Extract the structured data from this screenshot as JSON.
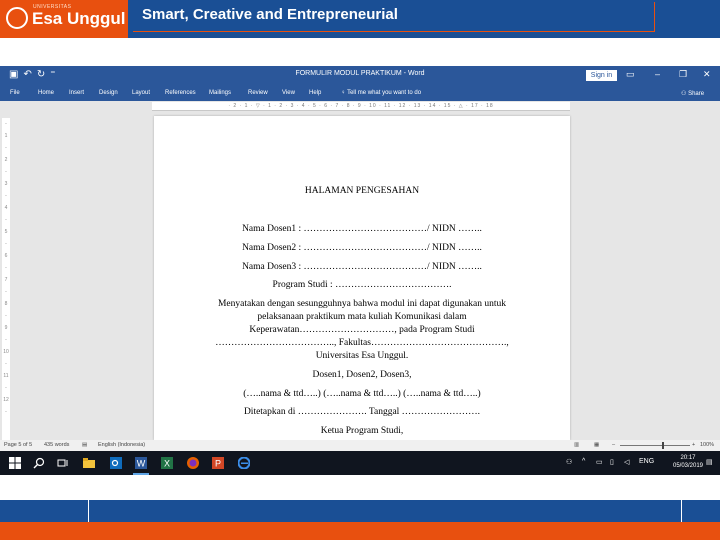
{
  "slide": {
    "logo_small": "UNIVERSITAS",
    "logo_text": "Esa Unggul",
    "banner_title": "Smart, Creative and Entrepreneurial"
  },
  "word": {
    "doc_title": "FORMULIR MODUL PRAKTIKUM - Word",
    "signin": "Sign in",
    "tabs": [
      "File",
      "Home",
      "Insert",
      "Design",
      "Layout",
      "References",
      "Mailings",
      "Review",
      "View",
      "Help"
    ],
    "tell_me": "Tell me what you want to do",
    "share": "Share"
  },
  "document": {
    "heading": "HALAMAN PENGESAHAN",
    "lines": [
      "Nama Dosen1 : …………………………………/ NIDN ……..",
      "Nama Dosen2 : …………………………………/ NIDN ……..",
      "Nama Dosen3 : …………………………………/ NIDN ……..",
      "Program Studi : ……………………………….",
      "Menyatakan dengan sesungguhnya bahwa modul ini dapat digunakan untuk",
      "pelaksanaan praktikum mata kuliah Komunikasi dalam",
      "Keperawatan…………………………, pada Program Studi",
      "……………………………….., Fakultas…………………………………….,",
      "Universitas Esa Unggul.",
      "Dosen1, Dosen2, Dosen3,",
      "(…..nama & ttd…..) (…..nama & ttd…..) (…..nama & ttd…..)",
      "Ditetapkan di …………………. Tanggal …………………….",
      "Ketua Program Studi,"
    ]
  },
  "status": {
    "page": "Page 5 of 5",
    "words": "435 words",
    "language": "English (Indonesia)",
    "zoom": "100%"
  },
  "taskbar": {
    "lang": "ENG",
    "time": "20:17",
    "date": "05/03/2019"
  },
  "colors": {
    "brand_blue": "#1a4f95",
    "brand_orange": "#e8500f",
    "word_blue": "#2b579a"
  }
}
